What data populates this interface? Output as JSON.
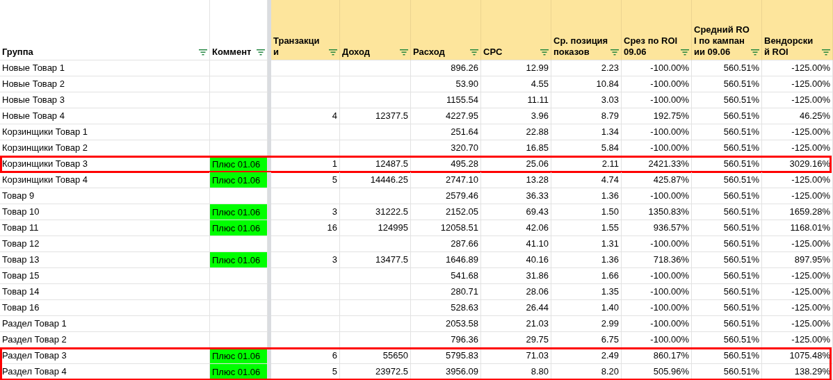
{
  "table": {
    "columns": [
      {
        "label": "Группа",
        "frozen": true
      },
      {
        "label": "Коммент",
        "frozen": true
      },
      {
        "label": "Транзакци и",
        "frozen": false
      },
      {
        "label": "Доход",
        "frozen": false
      },
      {
        "label": "Расход",
        "frozen": false
      },
      {
        "label": "CPC",
        "frozen": false
      },
      {
        "label": "Ср. позиция показов",
        "frozen": false
      },
      {
        "label": "Срез по ROI 09.06",
        "frozen": false
      },
      {
        "label": "Средний ROI по кампании 09.06",
        "frozen": false
      },
      {
        "label": "Вендорски й ROI",
        "frozen": false
      }
    ],
    "rows": [
      {
        "highlighted": false,
        "cells": [
          "Новые Товар 1",
          null,
          null,
          null,
          "896.26",
          "12.99",
          "2.23",
          "-100.00%",
          "560.51%",
          "-125.00%"
        ]
      },
      {
        "highlighted": false,
        "cells": [
          "Новые Товар 2",
          null,
          null,
          null,
          "53.90",
          "4.55",
          "10.84",
          "-100.00%",
          "560.51%",
          "-125.00%"
        ]
      },
      {
        "highlighted": false,
        "cells": [
          "Новые Товар 3",
          null,
          null,
          null,
          "1155.54",
          "11.11",
          "3.03",
          "-100.00%",
          "560.51%",
          "-125.00%"
        ]
      },
      {
        "highlighted": false,
        "cells": [
          "Новые Товар 4",
          null,
          "4",
          "12377.5",
          "4227.95",
          "3.96",
          "8.79",
          "192.75%",
          "560.51%",
          "46.25%"
        ]
      },
      {
        "highlighted": false,
        "cells": [
          "Корзинщики Товар 1",
          null,
          null,
          null,
          "251.64",
          "22.88",
          "1.34",
          "-100.00%",
          "560.51%",
          "-125.00%"
        ]
      },
      {
        "highlighted": false,
        "cells": [
          "Корзинщики Товар 2",
          null,
          null,
          null,
          "320.70",
          "16.85",
          "5.84",
          "-100.00%",
          "560.51%",
          "-125.00%"
        ]
      },
      {
        "highlighted": true,
        "cells": [
          "Корзинщики Товар 3",
          "Плюс 01.06",
          "1",
          "12487.5",
          "495.28",
          "25.06",
          "2.11",
          "2421.33%",
          "560.51%",
          "3029.16%"
        ]
      },
      {
        "highlighted": false,
        "cells": [
          "Корзинщики Товар 4",
          "Плюс 01.06",
          "5",
          "14446.25",
          "2747.10",
          "13.28",
          "4.74",
          "425.87%",
          "560.51%",
          "-125.00%"
        ]
      },
      {
        "highlighted": false,
        "cells": [
          "Товар 9",
          null,
          null,
          null,
          "2579.46",
          "36.33",
          "1.36",
          "-100.00%",
          "560.51%",
          "-125.00%"
        ]
      },
      {
        "highlighted": false,
        "cells": [
          "Товар 10",
          "Плюс 01.06",
          "3",
          "31222.5",
          "2152.05",
          "69.43",
          "1.50",
          "1350.83%",
          "560.51%",
          "1659.28%"
        ]
      },
      {
        "highlighted": false,
        "cells": [
          "Товар 11",
          "Плюс 01.06",
          "16",
          "124995",
          "12058.51",
          "42.06",
          "1.55",
          "936.57%",
          "560.51%",
          "1168.01%"
        ]
      },
      {
        "highlighted": false,
        "cells": [
          "Товар 12",
          null,
          null,
          null,
          "287.66",
          "41.10",
          "1.31",
          "-100.00%",
          "560.51%",
          "-125.00%"
        ]
      },
      {
        "highlighted": false,
        "cells": [
          "Товар 13",
          "Плюс 01.06",
          "3",
          "13477.5",
          "1646.89",
          "40.16",
          "1.36",
          "718.36%",
          "560.51%",
          "897.95%"
        ]
      },
      {
        "highlighted": false,
        "cells": [
          "Товар 15",
          null,
          null,
          null,
          "541.68",
          "31.86",
          "1.66",
          "-100.00%",
          "560.51%",
          "-125.00%"
        ]
      },
      {
        "highlighted": false,
        "cells": [
          "Товар 14",
          null,
          null,
          null,
          "280.71",
          "28.06",
          "1.35",
          "-100.00%",
          "560.51%",
          "-125.00%"
        ]
      },
      {
        "highlighted": false,
        "cells": [
          "Товар 16",
          null,
          null,
          null,
          "528.63",
          "26.44",
          "1.40",
          "-100.00%",
          "560.51%",
          "-125.00%"
        ]
      },
      {
        "highlighted": false,
        "cells": [
          "Раздел Товар 1",
          null,
          null,
          null,
          "2053.58",
          "21.03",
          "2.99",
          "-100.00%",
          "560.51%",
          "-125.00%"
        ]
      },
      {
        "highlighted": false,
        "cells": [
          "Раздел Товар 2",
          null,
          null,
          null,
          "796.36",
          "29.75",
          "6.75",
          "-100.00%",
          "560.51%",
          "-125.00%"
        ]
      },
      {
        "highlighted": true,
        "cells": [
          "Раздел Товар 3",
          "Плюс 01.06",
          "6",
          "55650",
          "5795.83",
          "71.03",
          "2.49",
          "860.17%",
          "560.51%",
          "1075.48%"
        ]
      },
      {
        "highlighted": true,
        "cells": [
          "Раздел Товар 4",
          "Плюс 01.06",
          "5",
          "23972.5",
          "3956.09",
          "8.80",
          "8.20",
          "505.96%",
          "560.51%",
          "138.29%"
        ]
      }
    ]
  }
}
